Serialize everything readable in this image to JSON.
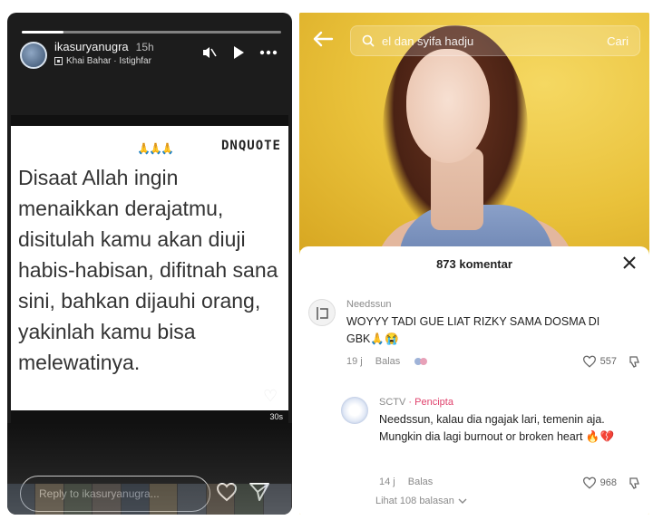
{
  "story": {
    "username": "ikasuryanugra",
    "time": "15h",
    "music": "Khai Bahar · Istighfar",
    "brand": "DNQUOTE",
    "emoji": "🙏🙏🙏",
    "quote": "Disaat Allah ingin menaikkan derajatmu, disitulah kamu akan diuji habis-habisan, difitnah sana sini, bahkan dijauhi orang, yakinlah kamu bisa melewatinya.",
    "watermark": "30s",
    "reply_placeholder": "Reply to ikasuryanugra...",
    "icons": [
      "mute-icon",
      "play-icon",
      "more-icon",
      "heart-icon",
      "send-icon"
    ]
  },
  "tiktok": {
    "search_query": "el dan syifa hadju",
    "search_button": "Cari",
    "comment_count": "873 komentar",
    "comments": [
      {
        "user": "Needssun",
        "text": "WOYYY TADI GUE LIAT RIZKY SAMA DOSMA DI GBK🙏😭",
        "age": "19 j",
        "reply_label": "Balas",
        "likes": "557"
      },
      {
        "user": "SCTV",
        "author_tag": "· Pencipta",
        "text": "Needssun, kalau dia ngajak lari, temenin aja. Mungkin dia lagi burnout or broken heart 🔥💔",
        "age": "14 j",
        "reply_label": "Balas",
        "likes": "968"
      }
    ],
    "view_replies": "Lihat 108 balasan",
    "colors": {
      "author": "#e0436d",
      "bg_yellow": "#e8c53a"
    }
  }
}
